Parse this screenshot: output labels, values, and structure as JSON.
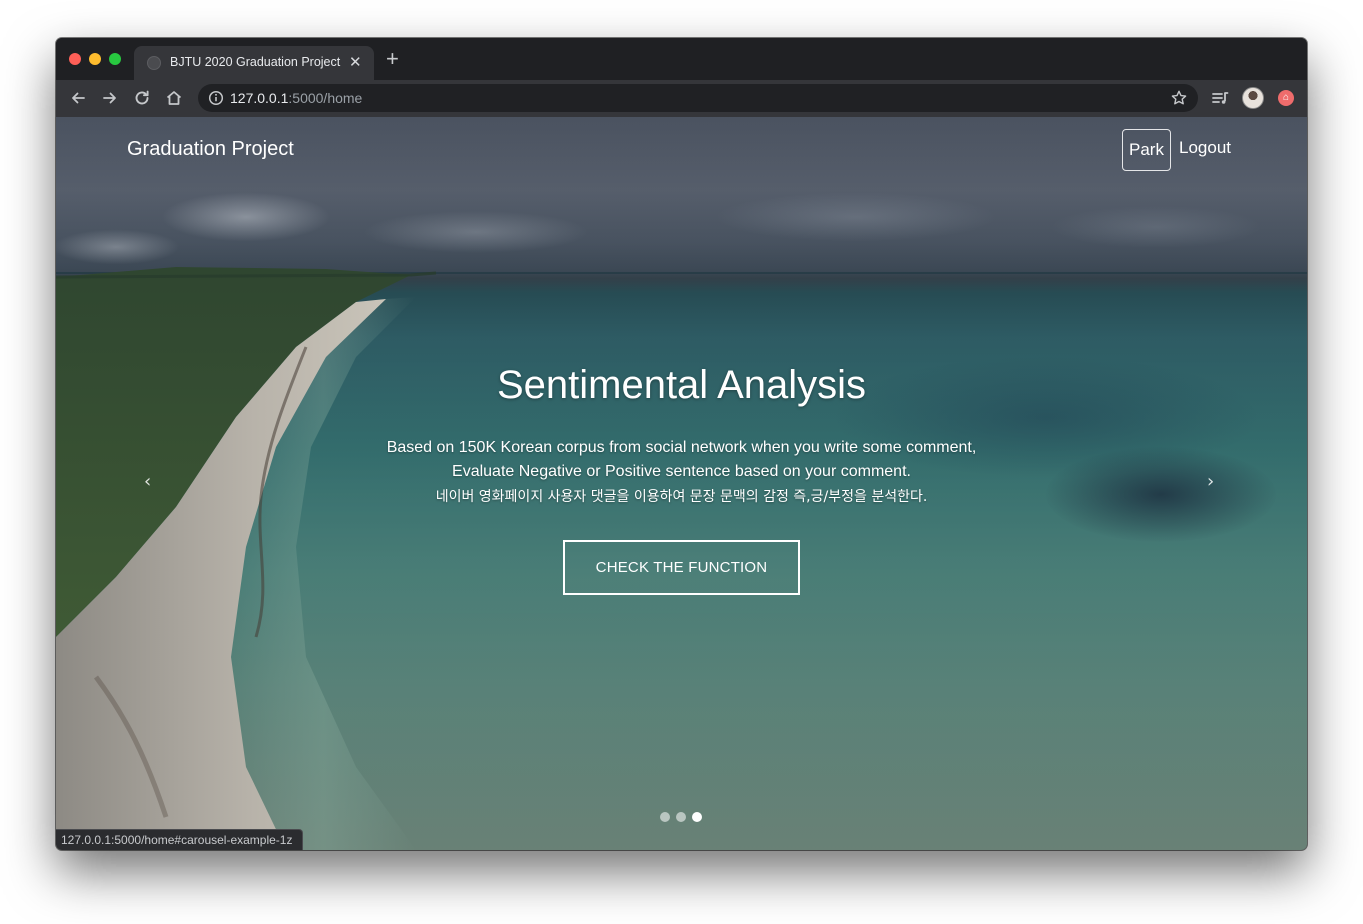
{
  "browser": {
    "tab_title": "BJTU 2020 Graduation Project",
    "tab_close": "✕",
    "new_tab": "+",
    "url_host": "127.0.0.1",
    "url_path": ":5000/home",
    "status_url": "127.0.0.1:5000/home#carousel-example-1z",
    "icons": [
      "back-icon",
      "forward-icon",
      "reload-icon",
      "home-icon",
      "info-icon",
      "star-icon",
      "media-queue-icon",
      "profile-avatar-icon",
      "extension-icon"
    ]
  },
  "nav": {
    "brand": "Graduation Project",
    "user": "Park",
    "logout": "Logout"
  },
  "hero": {
    "title": "Sentimental Analysis",
    "line1": "Based on 150K Korean corpus from social network when you write some comment,",
    "line2": "Evaluate Negative or Positive sentence based on your comment.",
    "line3": "네이버 영화페이지 사용자 댓글을 이용하여 문장 문맥의 감정 즉,긍/부정을 분석한다.",
    "cta": "CHECK THE FUNCTION"
  },
  "carousel": {
    "prev": "‹",
    "next": "›",
    "slide_count": 3,
    "active_index": 2
  },
  "colors": {
    "chrome_dark": "#1f2023",
    "toolbar": "#35363a",
    "text_white": "#ffffff"
  }
}
